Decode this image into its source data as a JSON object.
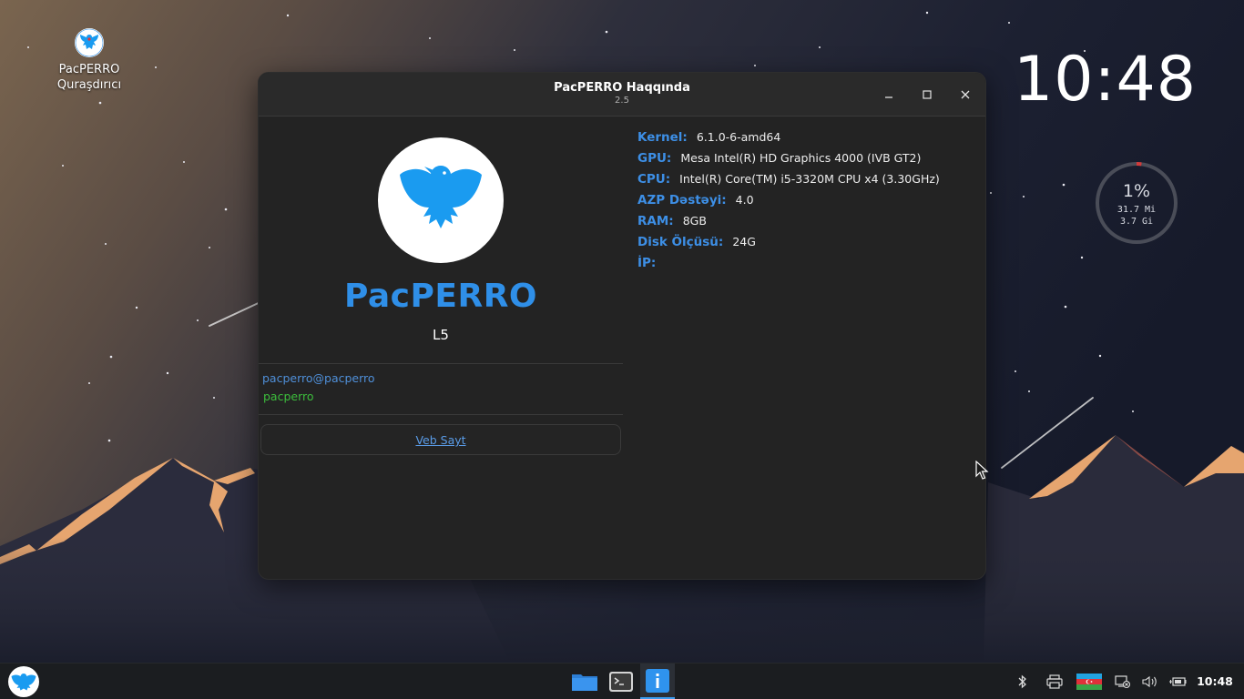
{
  "colors": {
    "accent": "#2f8fe8",
    "key_label": "#3d8fe6",
    "user_host": "#4f8fd8",
    "user_name": "#3cbd3c",
    "window_bg": "#232323",
    "taskbar_bg": "#1b1d20"
  },
  "desktop": {
    "icon": {
      "name": "pacperro-logo-icon",
      "label_line1": "PacPERRO",
      "label_line2": "Quraşdırıcı"
    },
    "clock": "10:48",
    "resource_widget": {
      "cpu_percent": "1%",
      "cpu_fraction": 0.01,
      "mem_used": "31.7 Mi",
      "mem_total": "3.7 Gi"
    }
  },
  "window": {
    "title": "PacPERRO Haqqında",
    "subtitle": "2.5",
    "controls": [
      "minimize-icon",
      "maximize-icon",
      "close-icon"
    ],
    "brand": "PacPERRO",
    "edition": "L5",
    "user_host": "pacperro@pacperro",
    "user_name": "pacperro",
    "website_link": "Veb Sayt",
    "info": [
      {
        "key": "Kernel:",
        "value": "6.1.0-6-amd64"
      },
      {
        "key": "GPU:",
        "value": "Mesa Intel(R) HD Graphics 4000 (IVB GT2)"
      },
      {
        "key": "CPU:",
        "value": "Intel(R) Core(TM) i5-3320M CPU x4 (3.30GHz)"
      },
      {
        "key": "AZP Dəstəyi:",
        "value": "4.0"
      },
      {
        "key": "RAM:",
        "value": "8GB"
      },
      {
        "key": "Disk Ölçüsü:",
        "value": "24G"
      },
      {
        "key": "İP:",
        "value": ""
      }
    ]
  },
  "taskbar": {
    "start": "pacperro-menu-icon",
    "apps": [
      "file-manager-icon",
      "terminal-icon",
      "info-app-icon"
    ],
    "tray": [
      "bluetooth-icon",
      "printer-icon",
      "azerbaijan-flag-icon",
      "network-icon",
      "volume-icon",
      "battery-icon"
    ],
    "clock": "10:48"
  }
}
